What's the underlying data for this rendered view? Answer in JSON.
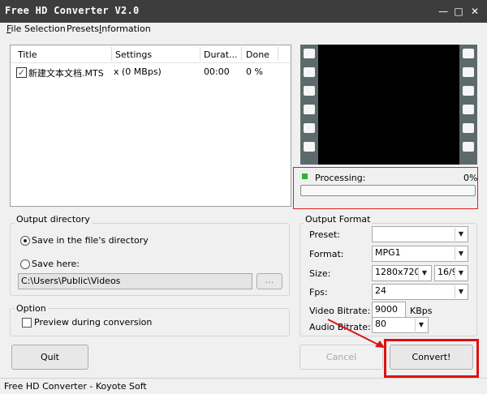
{
  "window": {
    "title": "Free HD Converter V2.0"
  },
  "menu": [
    {
      "label": "File",
      "mnemonic": "F",
      "rest": "ile"
    },
    {
      "label": "Selection",
      "mnemonic": "",
      "rest": "Selection"
    },
    {
      "label": "Presets",
      "mnemonic": "",
      "rest": "Presets"
    },
    {
      "label": "Information",
      "mnemonic": "I",
      "rest": "nformation"
    }
  ],
  "file_list": {
    "headers": [
      "Title",
      "Settings",
      "Durat...",
      "Done"
    ],
    "rows": [
      {
        "checked": true,
        "title": "新建文本文档.MTS",
        "settings": "x (0 MBps)",
        "duration": "00:00",
        "done": "0 %"
      }
    ]
  },
  "progress": {
    "label": "Processing:",
    "percent_text": "0%",
    "value": 0
  },
  "output_directory": {
    "group_label": "Output directory",
    "option_same": "Save in the file's directory",
    "option_here": "Save here:",
    "selected": "same",
    "path": "C:\\Users\\Public\\Videos",
    "browse_label": "..."
  },
  "option": {
    "group_label": "Option",
    "preview_label": "Preview during conversion",
    "preview_checked": false
  },
  "output_format": {
    "group_label": "Output Format",
    "preset_label": "Preset:",
    "preset_value": "",
    "format_label": "Format:",
    "format_value": "MPG1",
    "size_label": "Size:",
    "size_value": "1280x720",
    "aspect_value": "16/9",
    "fps_label": "Fps:",
    "fps_value": "24",
    "video_bitrate_label": "Video Bitrate:",
    "video_bitrate_value": "9000",
    "video_bitrate_unit": "KBps",
    "audio_bitrate_label": "Audio Bitrate:",
    "audio_bitrate_value": "80"
  },
  "buttons": {
    "quit": "Quit",
    "cancel": "Cancel",
    "convert": "Convert!"
  },
  "status_bar": {
    "text": "Free HD Converter - Koyote Soft"
  },
  "colors": {
    "titlebar": "#3d3d3d",
    "highlight": "#e01010",
    "led": "#2db42d"
  }
}
